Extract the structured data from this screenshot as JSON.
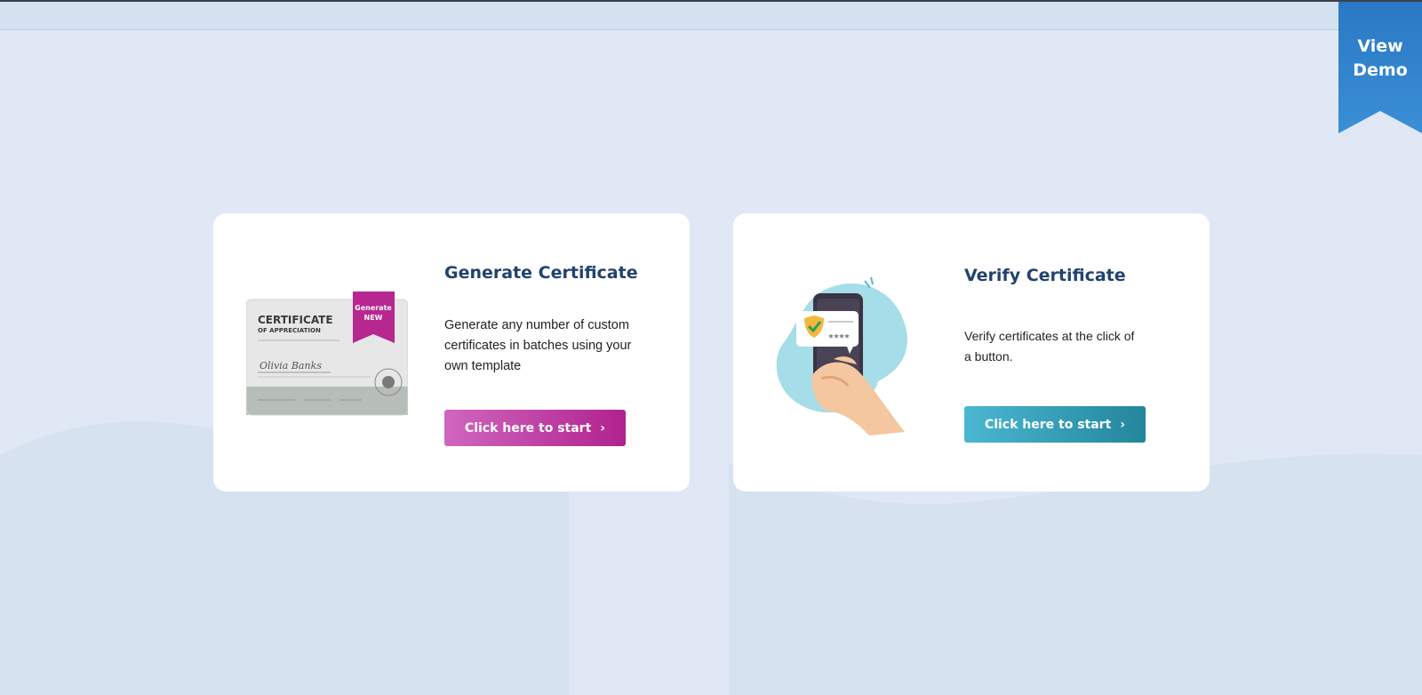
{
  "ribbon": {
    "line1": "View",
    "line2": "Demo"
  },
  "generate": {
    "title": "Generate Certificate",
    "description": "Generate any number of custom certificates in batches using your own template",
    "button_label": "Click here to start",
    "illustration": {
      "heading": "CERTIFICATE",
      "subheading": "OF APPRECIATION",
      "signature": "Olivia Banks",
      "badge_top": "Generate",
      "badge_bottom": "NEW"
    }
  },
  "verify": {
    "title": "Verify Certificate",
    "description": "Verify certificates at the click of a button.",
    "button_label": "Click here to start",
    "illustration": {
      "code": "****"
    }
  },
  "colors": {
    "background": "#dfe8f4",
    "title": "#22426e",
    "generate_button": "#b0228e",
    "verify_button": "#23869c",
    "ribbon": "#2a78c4"
  },
  "icons": [
    "chevron-right-icon",
    "shield-check-icon"
  ]
}
